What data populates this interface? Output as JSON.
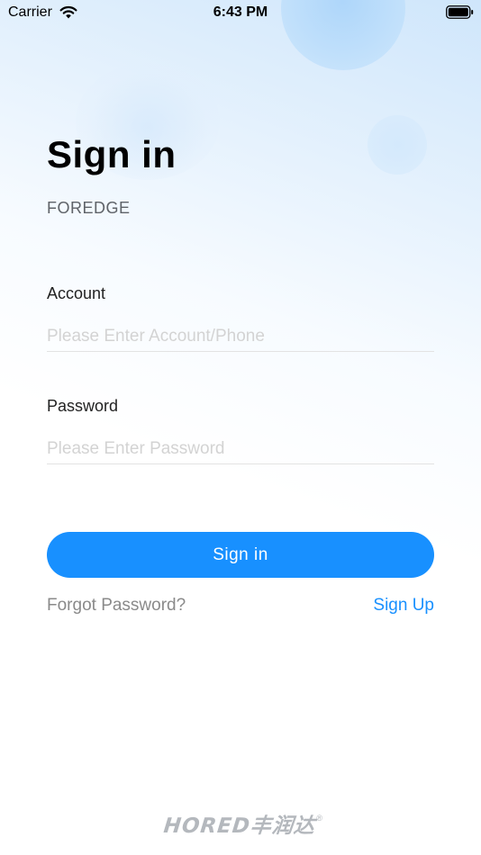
{
  "status_bar": {
    "carrier": "Carrier",
    "time": "6:43 PM",
    "wifi_icon": "wifi-icon",
    "battery_icon": "battery-icon"
  },
  "header": {
    "title": "Sign in",
    "subtitle": "FOREDGE"
  },
  "form": {
    "account_label": "Account",
    "account_placeholder": "Please Enter Account/Phone",
    "account_value": "",
    "password_label": "Password",
    "password_placeholder": "Please Enter Password",
    "password_value": ""
  },
  "actions": {
    "signin_label": "Sign in",
    "forgot_label": "Forgot Password?",
    "signup_label": "Sign Up"
  },
  "footer": {
    "brand": "HORED丰润达",
    "registered_mark": "®"
  },
  "colors": {
    "accent": "#1890ff",
    "muted_text": "#8a8a8a",
    "placeholder": "#d3d3d3",
    "background_tint": "#cfe6fb"
  }
}
